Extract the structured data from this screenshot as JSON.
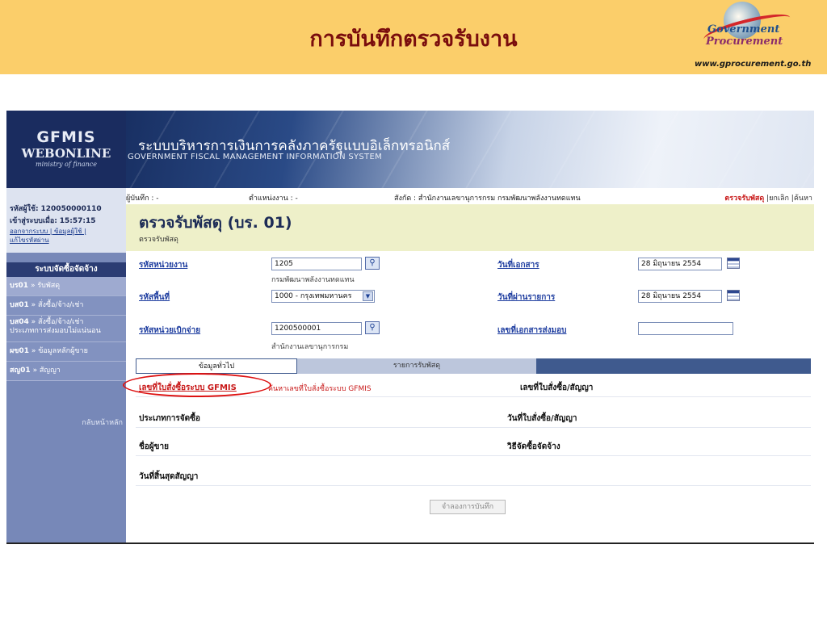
{
  "slide": {
    "title": "การบันทึกตรวจรับงาน",
    "logo": {
      "word1": "Government",
      "word2": "Procurement",
      "url": "www.gprocurement.go.th"
    }
  },
  "header": {
    "logo": {
      "line1": "GFMIS",
      "line2": "WEBONLINE",
      "line3": "ministry of finance"
    },
    "system_name_th": "ระบบบริหารการเงินการคลังภาครัฐแบบอิเล็กทรอนิกส์",
    "system_name_en": "GOVERNMENT FISCAL MANAGEMENT INFORMATION SYSTEM"
  },
  "sidebar": {
    "user_label": "รหัสผู้ใช้:",
    "user_id": "120050000110",
    "login_label": "เข้าสู่ระบบเมื่อ:",
    "login_time": "15:57:15",
    "links_line1": "ออกจากระบบ | ข้อมูลผู้ใช้ |",
    "links_line2": "แก้ไขรหัสผ่าน",
    "section_title": "ระบบจัดซื้อจัดจ้าง",
    "menu": [
      {
        "code": "บร01",
        "label": "» รับพัสดุ"
      },
      {
        "code": "บส01",
        "label": "» สั่งซื้อ/จ้าง/เช่า"
      },
      {
        "code": "บส04",
        "label": "» สั่งซื้อ/จ้าง/เช่า",
        "label2": "ประเภทการส่งมอบไม่แน่นอน"
      },
      {
        "code": "ผข01",
        "label": "» ข้อมูลหลักผู้ขาย"
      },
      {
        "code": "สญ01",
        "label": "» สัญญา"
      }
    ],
    "back_label": "กลับหน้าหลัก"
  },
  "info_bar": {
    "recorder": "ผู้บันทึก : -",
    "office": "ตำแหน่งงาน : -",
    "affiliation": "สังกัด : สำนักงานเลขานุการกรม กรมพัฒนาพลังงานทดแทน",
    "action_current": "ตรวจรับพัสดุ",
    "action_cancel": "|ยกเลิก",
    "action_search": "|ค้นหา"
  },
  "page": {
    "title": "ตรวจรับพัสดุ (บร. 01)",
    "subtitle": "ตรวจรับพัสดุ"
  },
  "form": {
    "unit_code": {
      "label": "รหัสหน่วยงาน",
      "value": "1205",
      "desc": "กรมพัฒนาพลังงานทดแทน"
    },
    "area_code": {
      "label": "รหัสพื้นที่",
      "value": "1000 - กรุงเทพมหานคร"
    },
    "disbursing_unit": {
      "label": "รหัสหน่วยเบิกจ่าย",
      "value": "1200500001",
      "desc": "สำนักงานเลขานุการกรม"
    },
    "doc_date": {
      "label": "วันที่เอกสาร",
      "value": "28 มิถุนายน 2554"
    },
    "posting_date": {
      "label": "วันที่ผ่านรายการ",
      "value": "28 มิถุนายน 2554"
    },
    "delivery_doc_no": {
      "label": "เลขที่เอกสารส่งมอบ",
      "value": ""
    }
  },
  "tabs": [
    {
      "label": "ข้อมูลทั่วไป",
      "active": true
    },
    {
      "label": "รายการรับพัสดุ",
      "active": false
    }
  ],
  "general": {
    "po_no_label": "เลขที่ใบสั่งซื้อระบบ GFMIS",
    "po_search_text": "ค้นหาเลขที่ใบสั่งซื้อระบบ GFMIS",
    "po_contract_no_label": "เลขที่ใบสั่งซื้อ/สัญญา",
    "procurement_type_label": "ประเภทการจัดซื้อ",
    "po_contract_date_label": "วันที่ใบสั่งซื้อ/สัญญา",
    "vendor_name_label": "ชื่อผู้ขาย",
    "procurement_method_label": "วิธีจัดซื้อจัดจ้าง",
    "contract_end_date_label": "วันที่สิ้นสุดสัญญา"
  },
  "buttons": {
    "simulate_save": "จำลองการบันทึก"
  },
  "icons": {
    "search": "magnifier-icon",
    "calendar": "calendar-icon",
    "dropdown": "chevron-down-icon"
  },
  "colors": {
    "banner": "#fbce6a",
    "banner_title": "#7a0d0d",
    "header_dark": "#0c1d4a",
    "sidebar": "#7788b8",
    "title_band": "#eef0c9",
    "link_blue": "#1f3ea0",
    "link_red": "#c81818",
    "tab_bar": "#3f5a8e"
  }
}
